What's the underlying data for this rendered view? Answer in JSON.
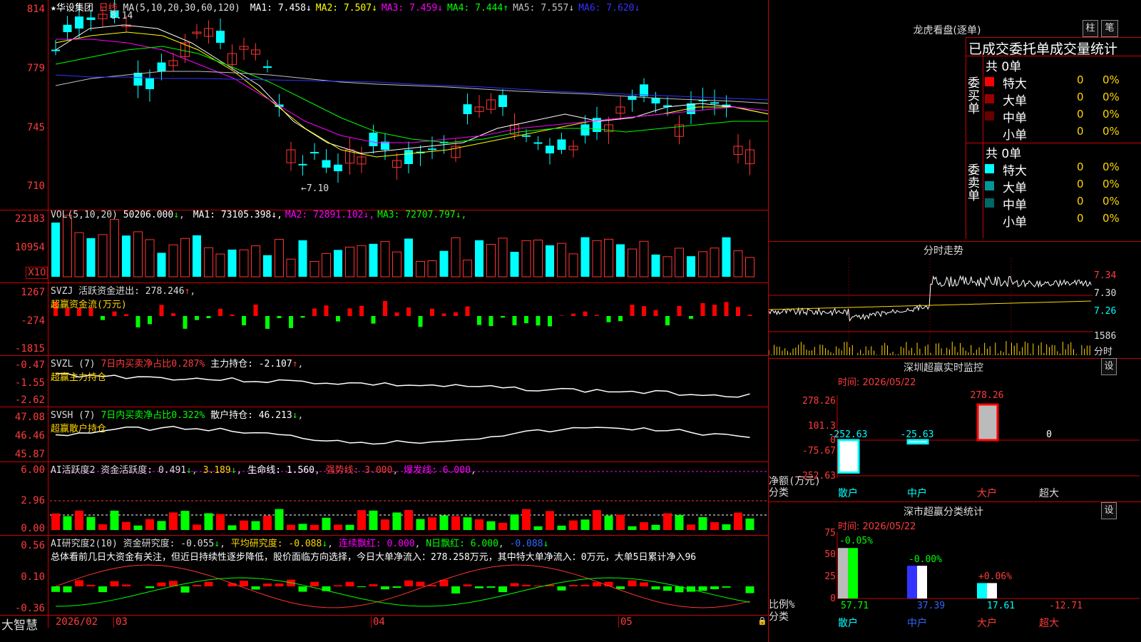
{
  "stock": {
    "name": "★华设集团",
    "period": "日线",
    "ma_label": "MA(5,10,20,30,60,120)",
    "ma": [
      {
        "name": "MA1",
        "value": "7.458",
        "arrow": "↓",
        "color": "#ffffff"
      },
      {
        "name": "MA2",
        "value": "7.507",
        "arrow": "↓",
        "color": "#ffff00"
      },
      {
        "name": "MA3",
        "value": "7.459",
        "arrow": "↓",
        "color": "#ff00ff"
      },
      {
        "name": "MA4",
        "value": "7.444",
        "arrow": "↑",
        "color": "#00ff00"
      },
      {
        "name": "MA5",
        "value": "7.557",
        "arrow": "↓",
        "color": "#c0c0c0"
      },
      {
        "name": "MA6",
        "value": "7.620",
        "arrow": "↓",
        "color": "#3333ff"
      }
    ],
    "high_mark": "8.14",
    "low_mark": "←7.10",
    "y_ticks": [
      "814",
      "779",
      "745",
      "710"
    ]
  },
  "vol": {
    "label": "VOL(5,10,20)",
    "value": "50206.000",
    "ma": [
      {
        "name": "MA1",
        "value": "73105.398",
        "arrow": "↓",
        "color": "#ffffff"
      },
      {
        "name": "MA2",
        "value": "72891.102",
        "arrow": "↓",
        "color": "#ff00ff"
      },
      {
        "name": "MA3",
        "value": "72707.797",
        "arrow": "↓",
        "color": "#00ff00"
      }
    ],
    "y_ticks": [
      "22183",
      "10954"
    ],
    "unit": "X10"
  },
  "svzj": {
    "label": "SVZJ  活跃资金进出: 278.246",
    "arrow": "↑",
    "sub": "超赢资金流(万元)",
    "y_ticks": [
      "1267",
      "-274",
      "-1815"
    ]
  },
  "svzl": {
    "label": "SVZL (7)",
    "pct": "7日内买卖净占比0.287%",
    "hold": "主力持仓: -2.107",
    "arrow": "↑",
    "sub": "超赢主力持仓",
    "y_ticks": [
      "-0.47",
      "-1.55",
      "-2.62"
    ]
  },
  "svsh": {
    "label": "SVSH (7)",
    "pct": "7日内买卖净占比0.322%",
    "hold": "散户持仓: 46.213",
    "arrow": "↓",
    "sub": "超赢散户持仓",
    "y_ticks": [
      "47.08",
      "46.46",
      "45.87"
    ]
  },
  "ai1": {
    "label": "AI活跃度2 资金活跃度: 0.491",
    "v2": "3.189",
    "v3": "生命线: 1.560",
    "v4": "强势线: 3.000",
    "v5": "爆发线: 6.000",
    "y_ticks": [
      "6.00",
      "2.96",
      "0.00"
    ]
  },
  "ai2": {
    "label": "AI研究度2(10) 资金研究度: -0.055",
    "v2": "平均研究度: -0.088",
    "v3": "连续飘红: 0.000",
    "v4": "N日飘红: 6.000",
    "v5": "-0.088",
    "text": "总体看前几日大资金有关注，但近日持续性逐步降低，股价面临方向选择，今日大单净流入：278.258万元，其中特大单净流入：0万元，大单5日累计净入96",
    "y_ticks": [
      "0.56",
      "0.10",
      "-0.36"
    ]
  },
  "bottom": {
    "brand": "大智慧",
    "dates": [
      "2026/02",
      "03",
      "04",
      "05"
    ]
  },
  "right": {
    "lhkp_title": "龙虎看盘(逐单)",
    "btn_zhu": "柱",
    "btn_bi": "笔",
    "stat_title": "已成交委托单成交量统计",
    "buy_label": "委买单",
    "sell_label": "委卖单",
    "buy_total": "共 0单",
    "sell_total": "共 0单",
    "buy_rows": [
      {
        "name": "特大",
        "n": "0",
        "pct": "0%",
        "color": "#ff0000"
      },
      {
        "name": "大单",
        "n": "0",
        "pct": "0%",
        "color": "#990000"
      },
      {
        "name": "中单",
        "n": "0",
        "pct": "0%",
        "color": "#660000"
      },
      {
        "name": "小单",
        "n": "0",
        "pct": "0%",
        "color": ""
      }
    ],
    "sell_rows": [
      {
        "name": "特大",
        "n": "0",
        "pct": "0%",
        "color": "#00ffff"
      },
      {
        "name": "大单",
        "n": "0",
        "pct": "0%",
        "color": "#009999"
      },
      {
        "name": "中单",
        "n": "0",
        "pct": "0%",
        "color": "#006666"
      },
      {
        "name": "小单",
        "n": "0",
        "pct": "0%",
        "color": ""
      }
    ],
    "intraday_title": "分时走势",
    "intraday_ticks": [
      "7.34",
      "7.30",
      "7.26",
      "1586"
    ],
    "intraday_unit": "分时",
    "sz_title": "深圳超赢实时监控",
    "sz_btn": "设",
    "sz_time": "时间: 2026/05/22",
    "sz_ticks": [
      "278.26",
      "101.3",
      "0",
      "-75.67",
      "-252.63"
    ],
    "sz_values": [
      "-252.63",
      "-25.63",
      "278.26",
      "0"
    ],
    "sz_cats": [
      "散户",
      "中户",
      "大户",
      "超大"
    ],
    "sz_axis_label": "净额(万元)",
    "sz_axis_label2": "分类",
    "cls_title": "深市超赢分类统计",
    "cls_btn": "设",
    "cls_time": "时间: 2026/05/22",
    "cls_ticks": [
      "75",
      "50",
      "25",
      "0"
    ],
    "cls_changes": [
      "-0.05%",
      "-0.00%",
      "+0.06%"
    ],
    "cls_values": [
      "57.71",
      "37.39",
      "17.61",
      "-12.71"
    ],
    "cls_cats": [
      "散户",
      "中户",
      "大户",
      "超大"
    ],
    "cls_axis_label": "比例%",
    "cls_axis_label2": "分类"
  }
}
